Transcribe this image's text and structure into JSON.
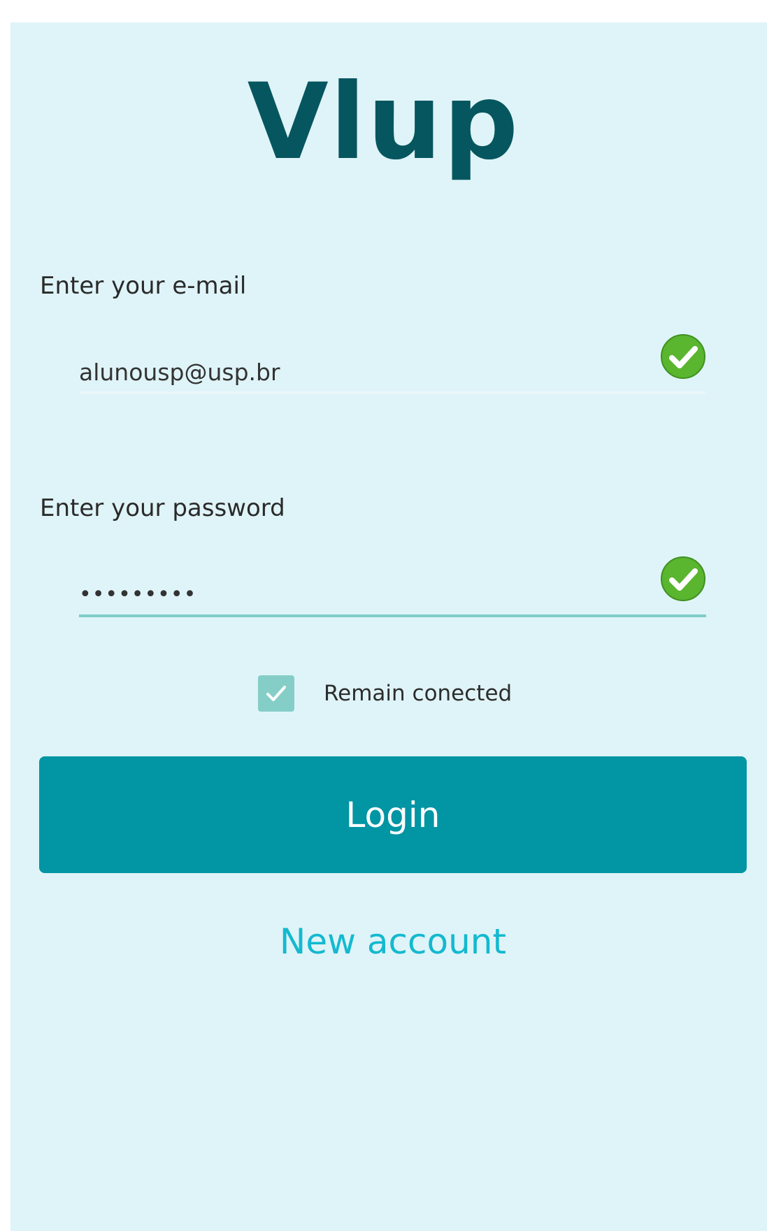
{
  "app": {
    "title": "Vlup"
  },
  "form": {
    "email": {
      "label": "Enter your e-mail",
      "value": "alunousp@usp.br",
      "status_icon": "check-circle-icon"
    },
    "password": {
      "label": "Enter your password",
      "value": "•••••••••",
      "status_icon": "check-circle-icon"
    },
    "remember": {
      "label": "Remain conected",
      "checked": true
    },
    "login_label": "Login",
    "new_account_label": "New account"
  },
  "colors": {
    "background": "#dff4f8",
    "brand": "#06565f",
    "button": "#0295a4",
    "link": "#13b9cf",
    "success": "#5ab52f",
    "checkbox": "#85cec8"
  }
}
